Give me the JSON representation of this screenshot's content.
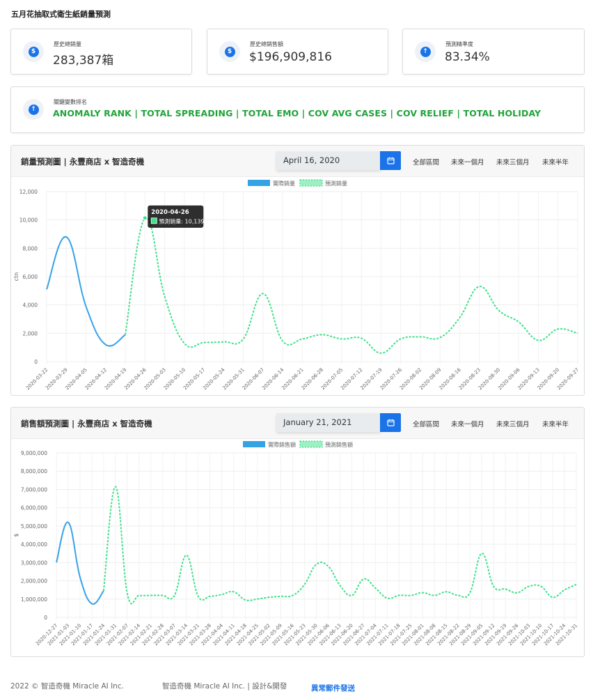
{
  "page": {
    "title": "五月花抽取式衛生紙銷量預測"
  },
  "stats": [
    {
      "label": "歷史總銷量",
      "value": "283,387箱",
      "icon": "dollar-icon",
      "glyph": "$"
    },
    {
      "label": "歷史總銷售額",
      "value": "$196,909,816",
      "icon": "dollar-icon",
      "glyph": "$"
    },
    {
      "label": "預測精準度",
      "value": "83.34%",
      "icon": "arrow-up-icon",
      "glyph": "↑"
    }
  ],
  "rank": {
    "label": "關鍵變數排名",
    "value": "ANOMALY RANK | TOTAL SPREADING | TOTAL EMO | COV AVG CASES | COV RELIEF | TOTAL HOLIDAY",
    "icon": "arrow-up-icon",
    "glyph": "↑"
  },
  "range_buttons": [
    "全部區間",
    "未來一個月",
    "未來三個月",
    "未來半年"
  ],
  "colors": {
    "actual": "#36a2e6",
    "predicted": "#3ee08a",
    "accent": "#1a73e8",
    "rank_text": "#21a33a"
  },
  "chart_data": [
    {
      "type": "line",
      "title": "銷量預測圖 | 永豐商店 x 智造奇機",
      "date": "April 16, 2020",
      "ylabel": "ctn",
      "ylim": [
        0,
        12000
      ],
      "yticks": [
        0,
        2000,
        4000,
        6000,
        8000,
        10000,
        12000
      ],
      "ytick_labels": [
        "0",
        "2,000",
        "4,000",
        "6,000",
        "8,000",
        "10,000",
        "12,000"
      ],
      "categories": [
        "2020-03-22",
        "2020-03-29",
        "2020-04-05",
        "2020-04-12",
        "2020-04-19",
        "2020-04-26",
        "2020-05-03",
        "2020-05-10",
        "2020-05-17",
        "2020-05-24",
        "2020-05-31",
        "2020-06-07",
        "2020-06-14",
        "2020-06-21",
        "2020-06-28",
        "2020-07-05",
        "2020-07-12",
        "2020-07-19",
        "2020-07-26",
        "2020-08-02",
        "2020-08-09",
        "2020-08-16",
        "2020-08-23",
        "2020-08-30",
        "2020-09-06",
        "2020-09-13",
        "2020-09-20",
        "2020-09-27"
      ],
      "series": [
        {
          "name": "實際銷量",
          "style": "solid",
          "x": [
            0,
            1,
            2,
            3,
            4
          ],
          "values": [
            5100,
            8800,
            3900,
            1200,
            1900
          ]
        },
        {
          "name": "預測銷量",
          "style": "dashed",
          "x": [
            4,
            5,
            6,
            7,
            8,
            9,
            10,
            11,
            12,
            13,
            14,
            15,
            16,
            17,
            18,
            19,
            20,
            21,
            22,
            23,
            24,
            25,
            26,
            27
          ],
          "values": [
            1900,
            10139,
            4600,
            1300,
            1350,
            1400,
            1600,
            4800,
            1450,
            1600,
            1900,
            1600,
            1650,
            600,
            1600,
            1750,
            1700,
            3100,
            5300,
            3600,
            2800,
            1500,
            2300,
            2000
          ]
        }
      ],
      "tooltip": {
        "date": "2020-04-26",
        "text": "預測銷量: 10,139",
        "index": 5
      }
    },
    {
      "type": "line",
      "title": "銷售額預測圖 | 永豐商店 x 智造奇機",
      "date": "January 21, 2021",
      "ylabel": "$",
      "ylim": [
        0,
        9000000
      ],
      "yticks": [
        0,
        1000000,
        2000000,
        3000000,
        4000000,
        5000000,
        6000000,
        7000000,
        8000000,
        9000000
      ],
      "ytick_labels": [
        "0",
        "1,000,000",
        "2,000,000",
        "3,000,000",
        "4,000,000",
        "5,000,000",
        "6,000,000",
        "7,000,000",
        "8,000,000",
        "9,000,000"
      ],
      "categories": [
        "2020-12-27",
        "2021-01-03",
        "2021-01-10",
        "2021-01-17",
        "2021-01-24",
        "2021-01-31",
        "2021-02-07",
        "2021-02-14",
        "2021-02-21",
        "2021-02-28",
        "2021-03-07",
        "2021-03-14",
        "2021-03-21",
        "2021-03-28",
        "2021-04-04",
        "2021-04-11",
        "2021-04-18",
        "2021-04-25",
        "2021-05-02",
        "2021-05-09",
        "2021-05-16",
        "2021-05-23",
        "2021-05-30",
        "2021-06-06",
        "2021-06-13",
        "2021-06-20",
        "2021-06-27",
        "2021-07-04",
        "2021-07-11",
        "2021-07-18",
        "2021-07-25",
        "2021-08-01",
        "2021-08-08",
        "2021-08-15",
        "2021-08-22",
        "2021-08-29",
        "2021-09-05",
        "2021-09-12",
        "2021-09-19",
        "2021-09-26",
        "2021-10-03",
        "2021-10-10",
        "2021-10-17",
        "2021-10-24",
        "2021-10-31"
      ],
      "series": [
        {
          "name": "實際銷售額",
          "style": "solid",
          "x": [
            0,
            1,
            2,
            3,
            4
          ],
          "values": [
            3000000,
            5200000,
            2200000,
            750000,
            1450000
          ]
        },
        {
          "name": "預測銷售額",
          "style": "dashed",
          "x": [
            4,
            5,
            6,
            7,
            8,
            9,
            10,
            11,
            12,
            13,
            14,
            15,
            16,
            17,
            18,
            19,
            20,
            21,
            22,
            23,
            24,
            25,
            26,
            27,
            28,
            29,
            30,
            31,
            32,
            33,
            34,
            35,
            36,
            37,
            38,
            39,
            40,
            41,
            42,
            43,
            44
          ],
          "values": [
            1450000,
            7150000,
            1300000,
            1200000,
            1200000,
            1200000,
            1200000,
            3400000,
            1150000,
            1150000,
            1250000,
            1400000,
            950000,
            1000000,
            1100000,
            1150000,
            1200000,
            1800000,
            2900000,
            2800000,
            1750000,
            1200000,
            2100000,
            1600000,
            1050000,
            1200000,
            1200000,
            1350000,
            1200000,
            1400000,
            1200000,
            1350000,
            3500000,
            1700000,
            1550000,
            1350000,
            1700000,
            1700000,
            1100000,
            1500000,
            1800000
          ]
        }
      ]
    }
  ],
  "footer": {
    "copyright": "2022 © 智造奇機 Miracle AI Inc.",
    "credit": "智造奇機 Miracle AI Inc. | 設計&開發",
    "link": "異常郵件發送"
  }
}
